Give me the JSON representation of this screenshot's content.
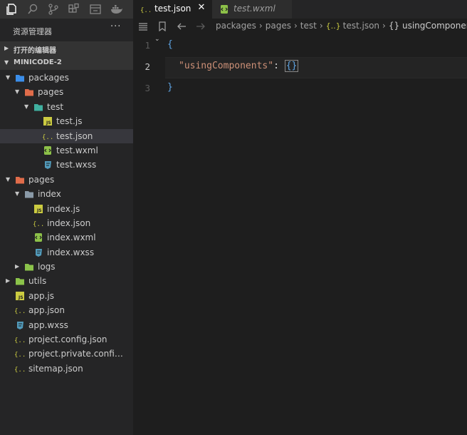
{
  "activity_bar": {
    "icons": [
      "explorer-icon",
      "search-icon",
      "source-control-icon",
      "extensions-icon",
      "remote-icon",
      "docker-icon"
    ]
  },
  "explorer": {
    "title": "资源管理器",
    "more": "···",
    "open_editors_label": "打开的编辑器",
    "workspace_label": "MINICODE-2"
  },
  "tree": [
    {
      "name": "packages",
      "depth": 1,
      "kind": "folder",
      "expanded": true,
      "color": "#3b8eea"
    },
    {
      "name": "pages",
      "depth": 2,
      "kind": "folder",
      "expanded": true,
      "color": "#e06c4a"
    },
    {
      "name": "test",
      "depth": 3,
      "kind": "folder",
      "expanded": true,
      "color": "#40b0a0"
    },
    {
      "name": "test.js",
      "depth": 4,
      "kind": "js"
    },
    {
      "name": "test.json",
      "depth": 4,
      "kind": "json",
      "selected": true
    },
    {
      "name": "test.wxml",
      "depth": 4,
      "kind": "wxml"
    },
    {
      "name": "test.wxss",
      "depth": 4,
      "kind": "wxss"
    },
    {
      "name": "pages",
      "depth": 1,
      "kind": "folder",
      "expanded": true,
      "color": "#e06c4a"
    },
    {
      "name": "index",
      "depth": 2,
      "kind": "folder",
      "expanded": true,
      "color": "#8a9aa8"
    },
    {
      "name": "index.js",
      "depth": 3,
      "kind": "js"
    },
    {
      "name": "index.json",
      "depth": 3,
      "kind": "json"
    },
    {
      "name": "index.wxml",
      "depth": 3,
      "kind": "wxml"
    },
    {
      "name": "index.wxss",
      "depth": 3,
      "kind": "wxss"
    },
    {
      "name": "logs",
      "depth": 2,
      "kind": "folder",
      "expanded": false,
      "color": "#8bc34a"
    },
    {
      "name": "utils",
      "depth": 1,
      "kind": "folder",
      "expanded": false,
      "color": "#8bc34a"
    },
    {
      "name": "app.js",
      "depth": 1,
      "kind": "js"
    },
    {
      "name": "app.json",
      "depth": 1,
      "kind": "json"
    },
    {
      "name": "app.wxss",
      "depth": 1,
      "kind": "wxss"
    },
    {
      "name": "project.config.json",
      "depth": 1,
      "kind": "json"
    },
    {
      "name": "project.private.config.js...",
      "depth": 1,
      "kind": "json"
    },
    {
      "name": "sitemap.json",
      "depth": 1,
      "kind": "json"
    }
  ],
  "tabs": {
    "active": {
      "label": "test.json",
      "close": "✕"
    },
    "inactive": {
      "label": "test.wxml"
    }
  },
  "breadcrumb": {
    "items": [
      "packages",
      "pages",
      "test",
      "test.json"
    ],
    "json_icon": "{..}",
    "last_prefix": "{}",
    "last": "usingComponents"
  },
  "code": {
    "lines": [
      {
        "num": "1",
        "open": "{"
      },
      {
        "num": "2",
        "key": "\"usingComponents\"",
        "colon": ": ",
        "value": "{}"
      },
      {
        "num": "3",
        "close": "}"
      }
    ]
  },
  "colors": {
    "js": "#cbcb41",
    "json": "#cbcb41",
    "wxml": "#8dc149",
    "wxss": "#519aba",
    "accent_selection": "#37373d"
  }
}
